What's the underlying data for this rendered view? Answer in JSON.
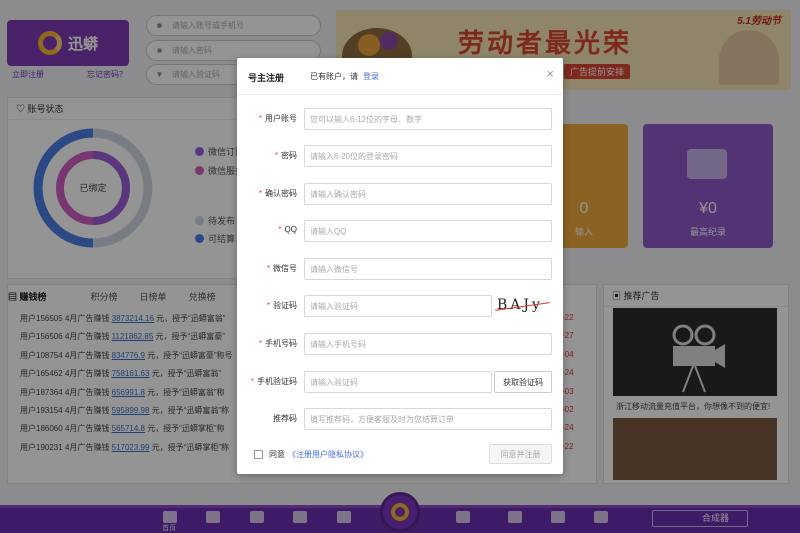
{
  "app": {
    "brand": "迅蟒"
  },
  "login": {
    "account_placeholder": "请输入账号或手机号",
    "password_placeholder": "请输入密码",
    "code_placeholder": "请输入验证码",
    "register_link": "立即注册",
    "forgot_link": "忘记密码？"
  },
  "banner": {
    "title": "劳动者最光荣",
    "subtitle": "广告提前安排",
    "tag": "5.1劳动节"
  },
  "account_status": {
    "title": "账号状态",
    "center_label": "已绑定",
    "legend": [
      "微信订阅",
      "微信服务",
      "待发布",
      "可结算"
    ]
  },
  "cards": [
    {
      "value": "0",
      "label": "输入"
    },
    {
      "value": "¥0",
      "label": "最高纪录"
    }
  ],
  "rankings": {
    "title": "赚钱榜",
    "tabs": [
      "赚钱榜",
      "积分榜",
      "日榜单",
      "兑换榜"
    ],
    "rows": [
      {
        "user": "用户156505",
        "text": "4月广告赚钱",
        "amount": "3873214.16",
        "suffix": "元，授予“迅蟒富翁”",
        "date": "-22"
      },
      {
        "user": "用户156506",
        "text": "4月广告赚钱",
        "amount": "1121862.85",
        "suffix": "元，授予“迅蟒富豪”",
        "date": "-27"
      },
      {
        "user": "用户108754",
        "text": "4月广告赚钱",
        "amount": "834776.9",
        "suffix": "元，授予“迅蟒富豪”称号",
        "date": "-04"
      },
      {
        "user": "用户165462",
        "text": "4月广告赚钱",
        "amount": "758161.63",
        "suffix": "元，授予“迅蟒富翁”",
        "date": "-24"
      },
      {
        "user": "用户187364",
        "text": "4月广告赚钱",
        "amount": "656991.8",
        "suffix": "元，授予“迅蟒富翁”称",
        "date": "-03"
      },
      {
        "user": "用户193154",
        "text": "4月广告赚钱",
        "amount": "595899.98",
        "suffix": "元，授予“迅蟒富翁”称",
        "date": "-02"
      },
      {
        "user": "用户186060",
        "text": "4月广告赚钱",
        "amount": "565714.8",
        "suffix": "元，授予“迅蟒掌柜”称",
        "date": "-24"
      },
      {
        "user": "用户190231",
        "text": "4月广告赚钱",
        "amount": "517023.99",
        "suffix": "元，授予“迅蟒掌柜”称",
        "date": "-22"
      }
    ]
  },
  "ads": {
    "title": "推荐广告",
    "caption": "浙江移动流量充值平台，你想像不到的便宜!"
  },
  "bottom_nav": {
    "items": [
      "首页",
      "",
      "",
      "",
      "",
      "",
      "",
      "",
      ""
    ],
    "synth_label": "合成器"
  },
  "modal": {
    "title": "号主注册",
    "has_account": "已有账户，请",
    "login_link": "登录",
    "close": "×",
    "fields": [
      {
        "label": "用户账号",
        "placeholder": "您可以输入6-12位的字母、数字"
      },
      {
        "label": "密码",
        "placeholder": "请输入6-20位的登录密码"
      },
      {
        "label": "确认密码",
        "placeholder": "请输入确认密码"
      },
      {
        "label": "QQ",
        "placeholder": "请输入QQ"
      },
      {
        "label": "微信号",
        "placeholder": "请输入微信号"
      },
      {
        "label": "验证码",
        "placeholder": "请输入验证码"
      },
      {
        "label": "手机号码",
        "placeholder": "请输入手机号码"
      },
      {
        "label": "手机验证码",
        "placeholder": "请输入验证码"
      },
      {
        "label": "推荐码",
        "placeholder": "填写推荐码，方便客服及时为您结算订单"
      }
    ],
    "captcha_text": "BAJy",
    "sms_button": "获取验证码",
    "agree_text": "同意",
    "protocol_link": "《注册用户隐私协议》",
    "submit_button": "同意并注册"
  },
  "colors": {
    "brand": "#7f3bb6",
    "accent_red": "#e43e30",
    "link": "#4a6de0"
  }
}
